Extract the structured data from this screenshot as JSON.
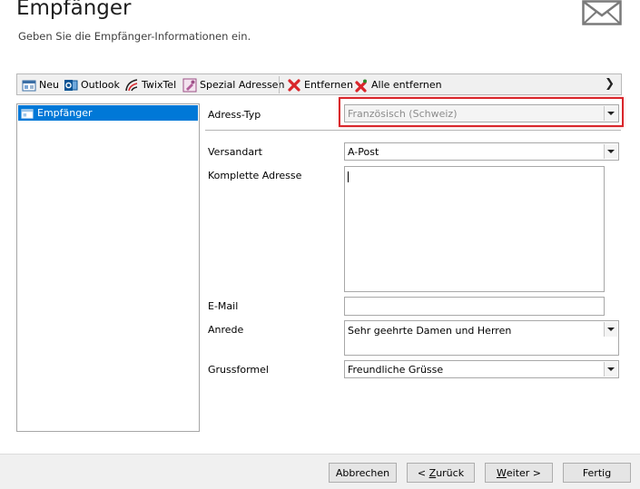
{
  "header": {
    "title": "Empfänger",
    "subtitle": "Geben Sie die Empfänger-Informationen ein."
  },
  "toolbar": {
    "new_label": "Neu",
    "outlook_label": "Outlook",
    "twixtel_label": "TwixTel",
    "special_label": "Spezial Adressen",
    "remove_label": "Entfernen",
    "remove_all_label": "Alle entfernen"
  },
  "recipients": {
    "items": [
      {
        "label": "Empfänger",
        "selected": true
      }
    ]
  },
  "form": {
    "address_type": {
      "label": "Adress-Typ",
      "value": "Französisch (Schweiz)"
    },
    "shipping": {
      "label": "Versandart",
      "value": "A-Post"
    },
    "full_address": {
      "label": "Komplette Adresse",
      "value": ""
    },
    "email": {
      "label": "E-Mail",
      "value": ""
    },
    "salutation": {
      "label": "Anrede",
      "value": "Sehr geehrte Damen und Herren"
    },
    "closing": {
      "label": "Grussformel",
      "value": "Freundliche Grüsse"
    }
  },
  "footer": {
    "cancel_label": "Abbrechen",
    "back_prefix": "< ",
    "back_key": "Z",
    "back_rest": "urück",
    "next_key": "W",
    "next_rest": "eiter >",
    "finish_label": "Fertig"
  },
  "colors": {
    "selection": "#0078d7",
    "highlight_border": "#d9262b",
    "remove_icon": "#d9262b"
  }
}
